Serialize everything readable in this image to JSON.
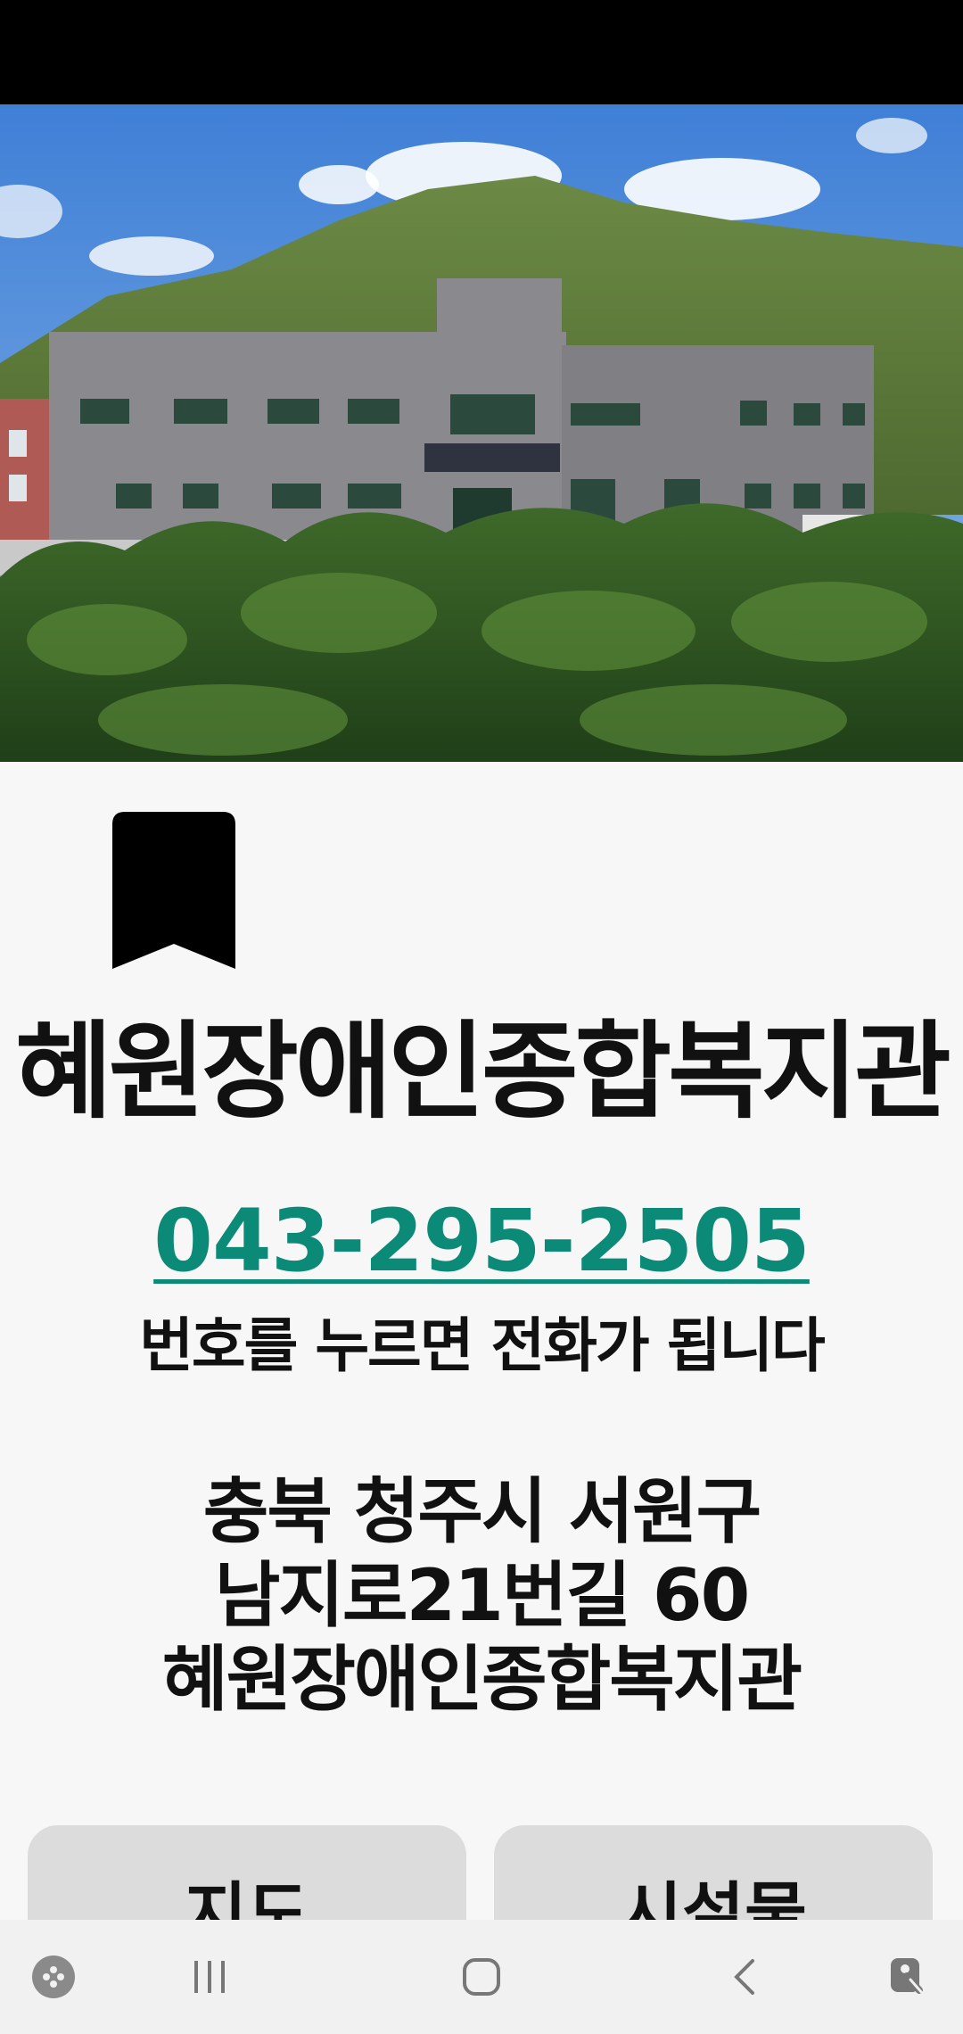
{
  "title": "혜원장애인종합복지관",
  "phone": {
    "number": "043-295-2505",
    "hint": "번호를 누르면 전화가 됩니다"
  },
  "address": {
    "line1": "충북 청주시 서원구",
    "line2": "남지로21번길 60",
    "line3": "혜원장애인종합복지관"
  },
  "buttons": {
    "map": "지도",
    "facility": "시설물"
  },
  "icons": {
    "bookmark": "bookmark-icon",
    "game": "game-launcher-icon",
    "recents": "recent-apps-icon",
    "home": "home-icon",
    "back": "back-icon",
    "accessibility": "accessibility-icon"
  },
  "colors": {
    "phone": "#0b8a78",
    "button_bg": "#dcdcdc"
  }
}
